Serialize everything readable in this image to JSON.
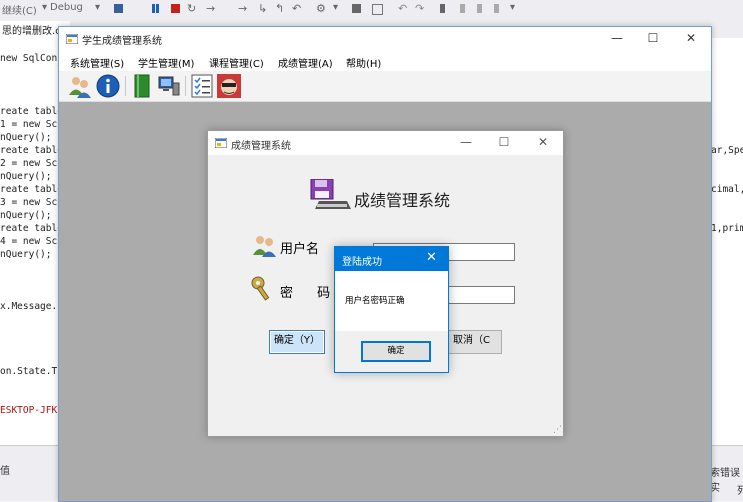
{
  "ide": {
    "toolbar": {
      "continue_label": "继续(C)",
      "config": "Debug"
    },
    "tab_label": "思的增删改.cs",
    "code_left": [
      "new SqlConn",
      "reate table",
      "1 = new Sc",
      "nQuery();",
      "reate table",
      "2 = new Sc",
      "nQuery();",
      "reate table",
      "3 = new Sc",
      "nQuery();",
      "reate table",
      "4 = new Sc",
      "nQuery();",
      "x.Message.",
      "on.State.T",
      "ESKTOP-JFK"
    ],
    "code_right": [
      "ar,Spe",
      "cimal,",
      "1,prim"
    ],
    "bottom_left": "值",
    "bottom_right": "索错误实",
    "bottom_right2": "列"
  },
  "main_window": {
    "title": "学生成绩管理系统",
    "controls": {
      "minimize": "—",
      "maximize": "☐",
      "close": "✕"
    },
    "menu": [
      "系统管理(S)",
      "学生管理(M)",
      "课程管理(C)",
      "成绩管理(A)",
      "帮助(H)"
    ],
    "toolstrip_icons": [
      "users-icon",
      "info-icon",
      "book-icon",
      "computer-icon",
      "checklist-icon",
      "face-icon"
    ]
  },
  "login_window": {
    "title": "成绩管理系统",
    "header": "成绩管理系统",
    "username_label": "用户名",
    "password_label": "密 码",
    "ok_button": "确定（Y）",
    "cancel_button": "取消（C",
    "controls": {
      "minimize": "—",
      "maximize": "☐",
      "close": "✕"
    }
  },
  "message_box": {
    "title": "登陆成功",
    "text": "用户名密码正确",
    "ok_button": "确定",
    "close": "✕"
  },
  "colors": {
    "accent": "#0078d7",
    "mdi_background": "#ababab",
    "form_background": "#f0f0f0"
  }
}
